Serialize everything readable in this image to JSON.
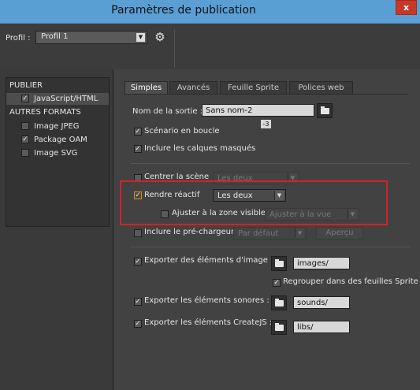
{
  "window": {
    "title": "Paramètres de publication",
    "close_glyph": "x"
  },
  "profile": {
    "label": "Profil :",
    "value": "Profil 1",
    "gear_icon": "gear-icon"
  },
  "sidebar": {
    "publish_header": "PUBLIER",
    "publish_items": [
      {
        "label": "JavaScript/HTML",
        "checked": true
      }
    ],
    "other_header": "AUTRES FORMATS",
    "other_items": [
      {
        "label": "Image JPEG",
        "checked": false
      },
      {
        "label": "Package OAM",
        "checked": true
      },
      {
        "label": "Image SVG",
        "checked": false
      }
    ]
  },
  "tabs": [
    "Simples",
    "Avancés",
    "Feuille Sprite",
    "Polices web"
  ],
  "form": {
    "output_label": "Nom de la sortie :",
    "output_value": "Sans nom-2",
    "badge": "-3",
    "loop_label": "Scénario en boucle",
    "hidden_layers_label": "Inclure les calques masqués",
    "center_label": "Centrer la scène",
    "center_value": "Les deux",
    "responsive_label": "Rendre réactif",
    "responsive_value": "Les deux",
    "fit_label": "Ajuster à la zone visible",
    "fit_value": "Ajuster à la vue",
    "preloader_label": "Inclure le pré-chargeur",
    "preloader_value": "Par défaut",
    "preview_button": "Aperçu",
    "export_images_label": "Exporter des éléments d'image :",
    "images_path": "images/",
    "sprite_label": "Regrouper dans des feuilles Sprite",
    "export_sounds_label": "Exporter les éléments sonores :",
    "sounds_path": "sounds/",
    "export_createjs_label": "Exporter les éléments CreateJS :",
    "libs_path": "libs/"
  },
  "colors": {
    "titlebar": "#5a9fd4",
    "close": "#c7382b",
    "highlight": "#d4212a",
    "accent_checkbox": "#d88b1a"
  }
}
